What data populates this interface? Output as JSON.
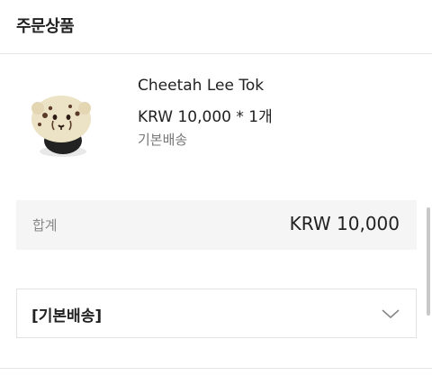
{
  "header": {
    "title": "주문상품"
  },
  "product": {
    "name": "Cheetah Lee Tok",
    "price_line": "KRW 10,000 * 1개",
    "shipping_type": "기본배송",
    "thumbnail_icon": "cheetah-phone-grip-icon"
  },
  "summary": {
    "total_label": "합계",
    "total_value": "KRW 10,000"
  },
  "shipping_group": {
    "label": "[기본배송]",
    "toggle_icon": "chevron-down-icon"
  }
}
